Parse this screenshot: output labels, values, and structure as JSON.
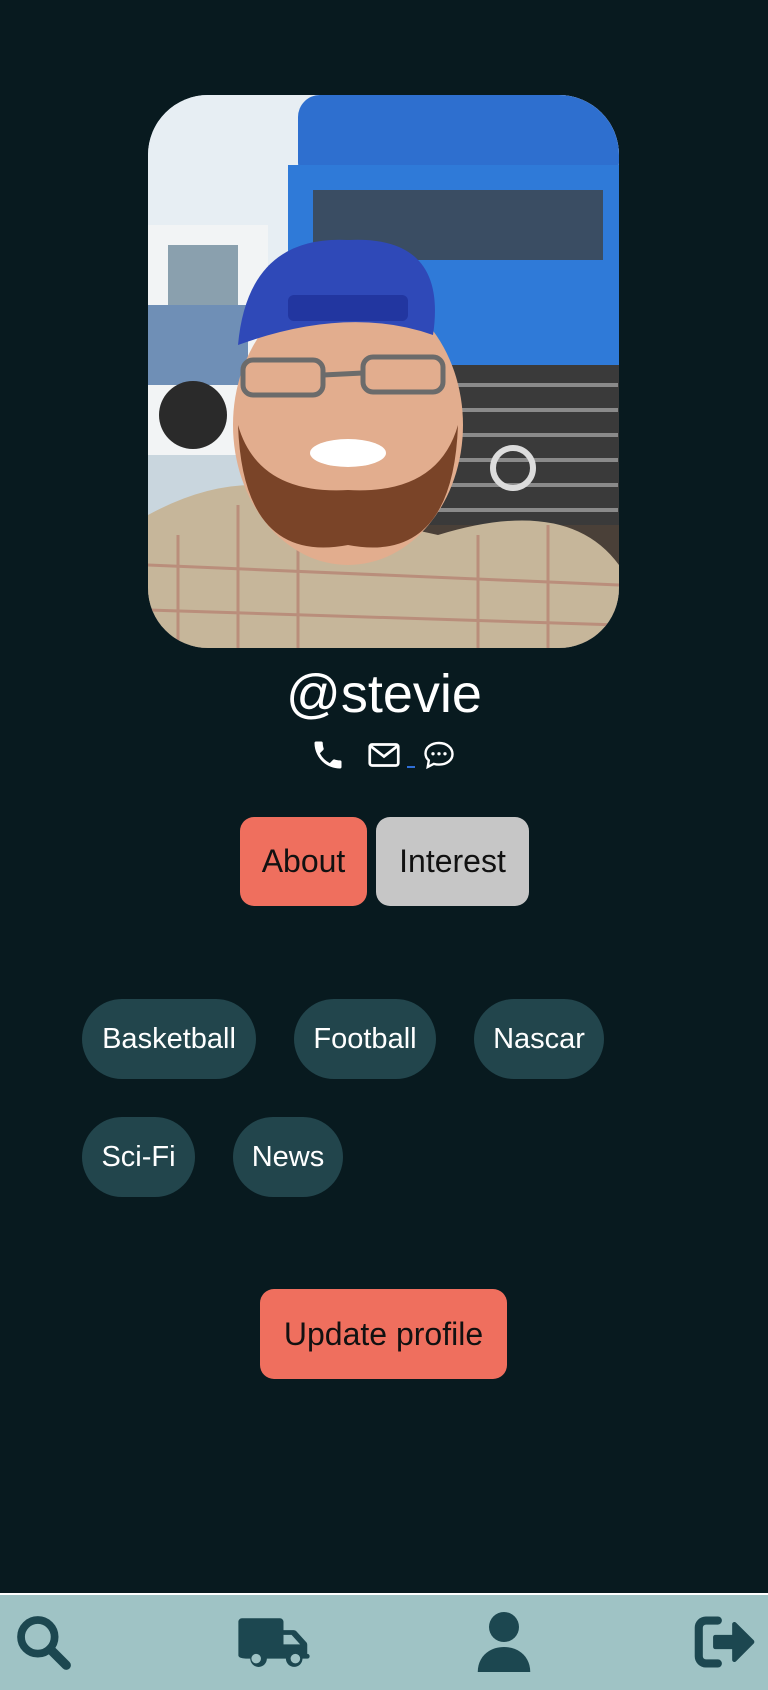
{
  "profile": {
    "username": "@stevie",
    "photo_alt": "profile-photo"
  },
  "contacts": {
    "icons": [
      "phone-icon",
      "envelope-icon",
      "chat-bubble-icon"
    ]
  },
  "tabs": {
    "about": "About",
    "interest": "Interest",
    "active": "about",
    "active_color": "#ef6f5e",
    "inactive_color": "#c6c6c6"
  },
  "interests": [
    "Basketball",
    "Football",
    "Nascar",
    "Sci-Fi",
    "News"
  ],
  "actions": {
    "update_profile": "Update profile"
  },
  "bottom_nav": {
    "items": [
      "search-icon",
      "truck-icon",
      "user-icon",
      "sign-out-icon"
    ],
    "background": "#9fc3c5",
    "icon_color": "#1c4750"
  },
  "theme": {
    "background": "#081a1f",
    "chip_color": "#22454c",
    "accent": "#ef6f5e"
  }
}
